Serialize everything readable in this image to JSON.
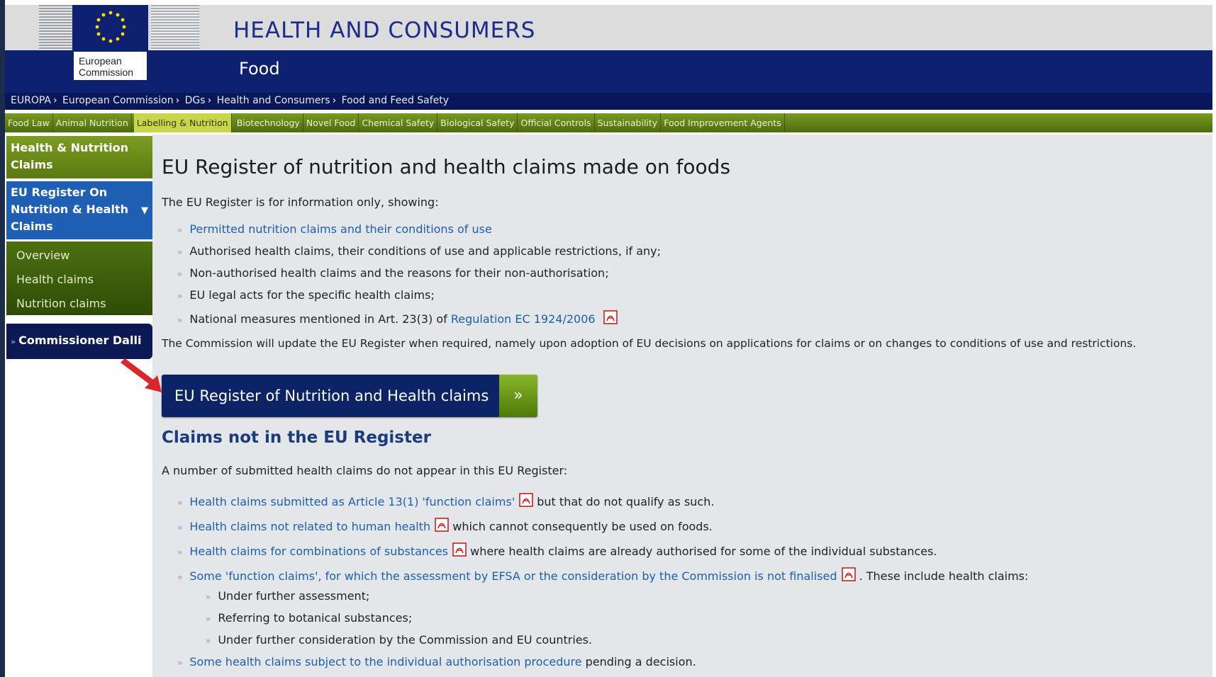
{
  "header": {
    "logo_line1": "European",
    "logo_line2": "Commission",
    "title": "HEALTH AND CONSUMERS",
    "subtitle": "Food"
  },
  "breadcrumb": [
    "EUROPA",
    "European Commission",
    "DGs",
    "Health and Consumers",
    "Food and Feed Safety"
  ],
  "topnav": [
    {
      "label": "Food Law",
      "active": false
    },
    {
      "label": "Animal Nutrition",
      "active": false
    },
    {
      "label": "Labelling & Nutrition",
      "active": true
    },
    {
      "label": "Biotechnology",
      "active": false
    },
    {
      "label": "Novel Food",
      "active": false
    },
    {
      "label": "Chemical Safety",
      "active": false
    },
    {
      "label": "Biological Safety",
      "active": false
    },
    {
      "label": "Official Controls",
      "active": false
    },
    {
      "label": "Sustainability",
      "active": false
    },
    {
      "label": "Food Improvement Agents",
      "active": false
    }
  ],
  "sidebar": {
    "section_title_1": "Health & Nutrition",
    "section_title_2": "Claims",
    "active_1": "EU Register On",
    "active_2": "Nutrition & Health",
    "active_3": "Claims",
    "sub_items": [
      "Overview",
      "Health claims",
      "Nutrition claims"
    ],
    "commissioner": "Commissioner Dalli"
  },
  "main": {
    "title": "EU Register of nutrition and health claims made on foods",
    "intro": "The EU Register is for information only, showing:",
    "list1": {
      "item1_link": "Permitted nutrition claims and their conditions of use",
      "item2": "Authorised health claims, their conditions of use and applicable restrictions, if any;",
      "item3": "Non-authorised health claims and the reasons for their non-authorisation;",
      "item4": "EU legal acts for the specific health claims;",
      "item5_text": "National measures mentioned in Art. 23(3) of ",
      "item5_link": "Regulation EC 1924/2006"
    },
    "update_text": "The Commission will update the EU Register when required, namely upon adoption of EU decisions on applications for claims or on changes to conditions of use and restrictions.",
    "button_label": "EU Register of Nutrition and Health claims",
    "button_arrow": "»",
    "subheading": "Claims not in the EU Register",
    "sub_intro": "A number of submitted health claims do not appear in this EU Register:",
    "list2": {
      "i1_link": "Health claims submitted as Article 13(1) 'function claims'",
      "i1_text": " but that do not qualify as such.",
      "i2_link": "Health claims not related to human health",
      "i2_text": " which cannot consequently be used on foods.",
      "i3_link": "Health claims for combinations of substances",
      "i3_text": " where health claims are already authorised for some of the individual substances.",
      "i4_link": "Some 'function claims', for which the assessment by EFSA or the consideration by the Commission is not finalised",
      "i4_text": " . These include health claims:",
      "sub1": "Under further assessment;",
      "sub2": "Referring to botanical substances;",
      "sub3": "Under further consideration by the Commission and EU countries.",
      "i5_link": "Some health claims subject to the individual authorisation procedure",
      "i5_text": " pending a decision."
    },
    "bullet_marker": "»"
  },
  "colors": {
    "header_blue": "#0e2070",
    "nav_green": "#5a7a10",
    "sidebar_active_blue": "#1f5fb4",
    "link_blue": "#1d5fae",
    "button_navy": "#0c2466",
    "arrow_red": "#d8262c"
  }
}
